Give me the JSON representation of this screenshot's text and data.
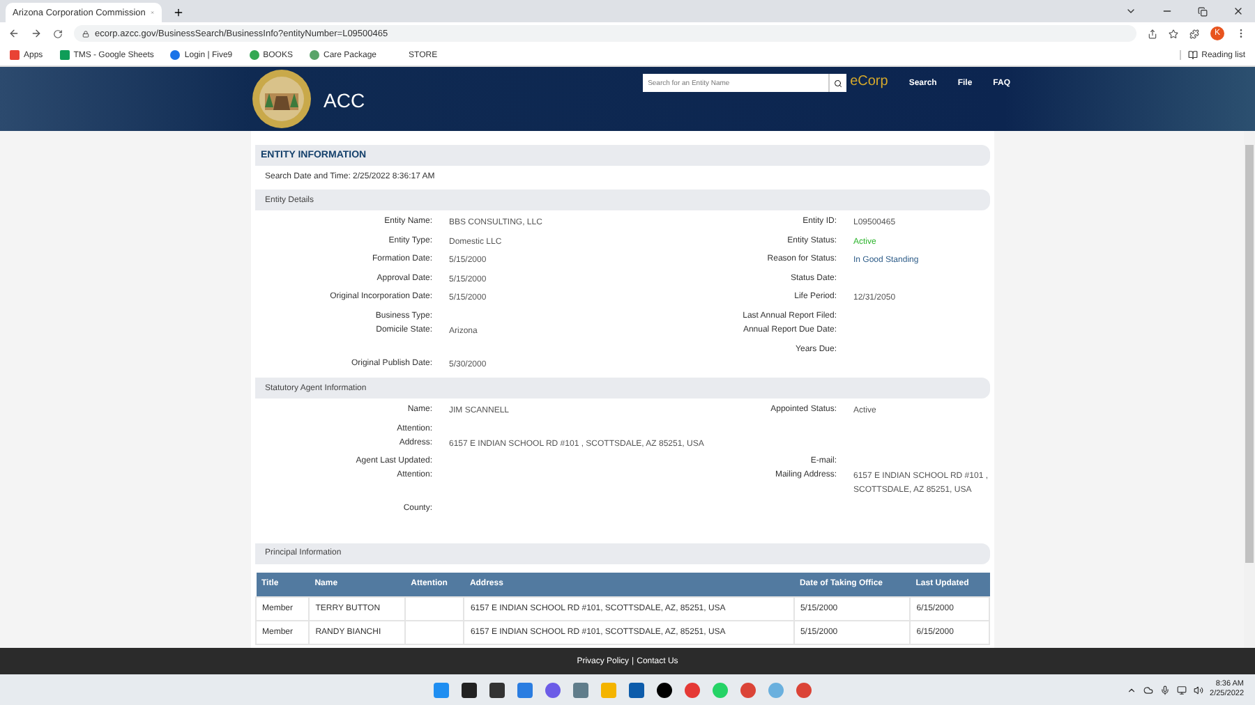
{
  "browser": {
    "tab_title": "Arizona Corporation Commission",
    "url": "ecorp.azcc.gov/BusinessSearch/BusinessInfo?entityNumber=L09500465",
    "profile_initial": "K",
    "bookmarks": [
      "Apps",
      "TMS - Google Sheets",
      "Login | Five9",
      "BOOKS",
      "Care Package",
      "STORE"
    ],
    "reading_list": "Reading list"
  },
  "header": {
    "agency": "ACC",
    "search_placeholder": "Search for an Entity Name",
    "brand": "eCorp",
    "nav": [
      "Search",
      "File",
      "FAQ"
    ]
  },
  "entity_information": {
    "title": "ENTITY INFORMATION",
    "search_date": "Search Date and Time: 2/25/2022 8:36:17 AM"
  },
  "entity_details": {
    "title": "Entity Details",
    "rows": [
      {
        "left": {
          "label": "Entity Name:",
          "value": "BBS CONSULTING, LLC"
        },
        "right": {
          "label": "Entity ID:",
          "value": "L09500465"
        }
      },
      {
        "left": {
          "label": "Entity Type:",
          "value": "Domestic LLC"
        },
        "right": {
          "label": "Entity Status:",
          "value": "Active",
          "color": "#2bb32b"
        }
      },
      {
        "left": {
          "label": "Formation Date:",
          "value": "5/15/2000"
        },
        "right": {
          "label": "Reason for Status:",
          "value": "In Good Standing",
          "color": "#2d5c88"
        }
      },
      {
        "left": {
          "label": "Approval Date:",
          "value": "5/15/2000"
        },
        "right": {
          "label": "Status Date:"
        }
      },
      {
        "left": {
          "label": "Original Incorporation Date:",
          "value": "5/15/2000"
        },
        "right": {
          "label": "Life Period:",
          "value": "12/31/2050"
        }
      },
      {
        "left": {
          "label": "Business Type:"
        },
        "right": {
          "label": "Last Annual Report Filed:"
        }
      },
      {
        "left": {
          "label": "Domicile State:",
          "value": "Arizona"
        },
        "right": {
          "label": "Annual Report Due Date:"
        }
      },
      {
        "right": {
          "label": "Years Due:"
        }
      },
      {
        "left": {
          "label": "Original Publish Date:",
          "value": "5/30/2000"
        }
      }
    ]
  },
  "statutory_agent": {
    "title": "Statutory Agent Information",
    "rows": [
      {
        "left": {
          "label": "Name:",
          "value": "JIM SCANNELL"
        },
        "right": {
          "label": "Appointed Status:",
          "value": "Active"
        }
      },
      {
        "left": {
          "label": "Attention:"
        }
      },
      {
        "left": {
          "label": "Address:",
          "value": "6157 E INDIAN SCHOOL RD #101 , SCOTTSDALE, AZ 85251, USA"
        }
      },
      {
        "left": {
          "label": "Agent Last Updated:"
        },
        "right": {
          "label": "E-mail:"
        }
      },
      {
        "left": {
          "label": "Attention:"
        },
        "right": {
          "label": "Mailing Address:",
          "value": "6157 E INDIAN SCHOOL RD #101 , SCOTTSDALE, AZ 85251, USA"
        }
      },
      {
        "left": {
          "label": "County:"
        }
      }
    ]
  },
  "principal_information": {
    "title": "Principal Information",
    "columns": [
      "Title",
      "Name",
      "Attention",
      "Address",
      "Date of Taking Office",
      "Last Updated"
    ],
    "rows": [
      [
        "Member",
        "TERRY BUTTON",
        "",
        "6157 E INDIAN SCHOOL RD #101, SCOTTSDALE, AZ, 85251, USA",
        "5/15/2000",
        "6/15/2000"
      ],
      [
        "Member",
        "RANDY BIANCHI",
        "",
        "6157 E INDIAN SCHOOL RD #101, SCOTTSDALE, AZ, 85251, USA",
        "5/15/2000",
        "6/15/2000"
      ]
    ]
  },
  "footer": {
    "links": [
      "Privacy Policy",
      "Contact Us"
    ],
    "separator": "|"
  },
  "taskbar": {
    "time": "8:36 AM",
    "date": "2/25/2022"
  }
}
